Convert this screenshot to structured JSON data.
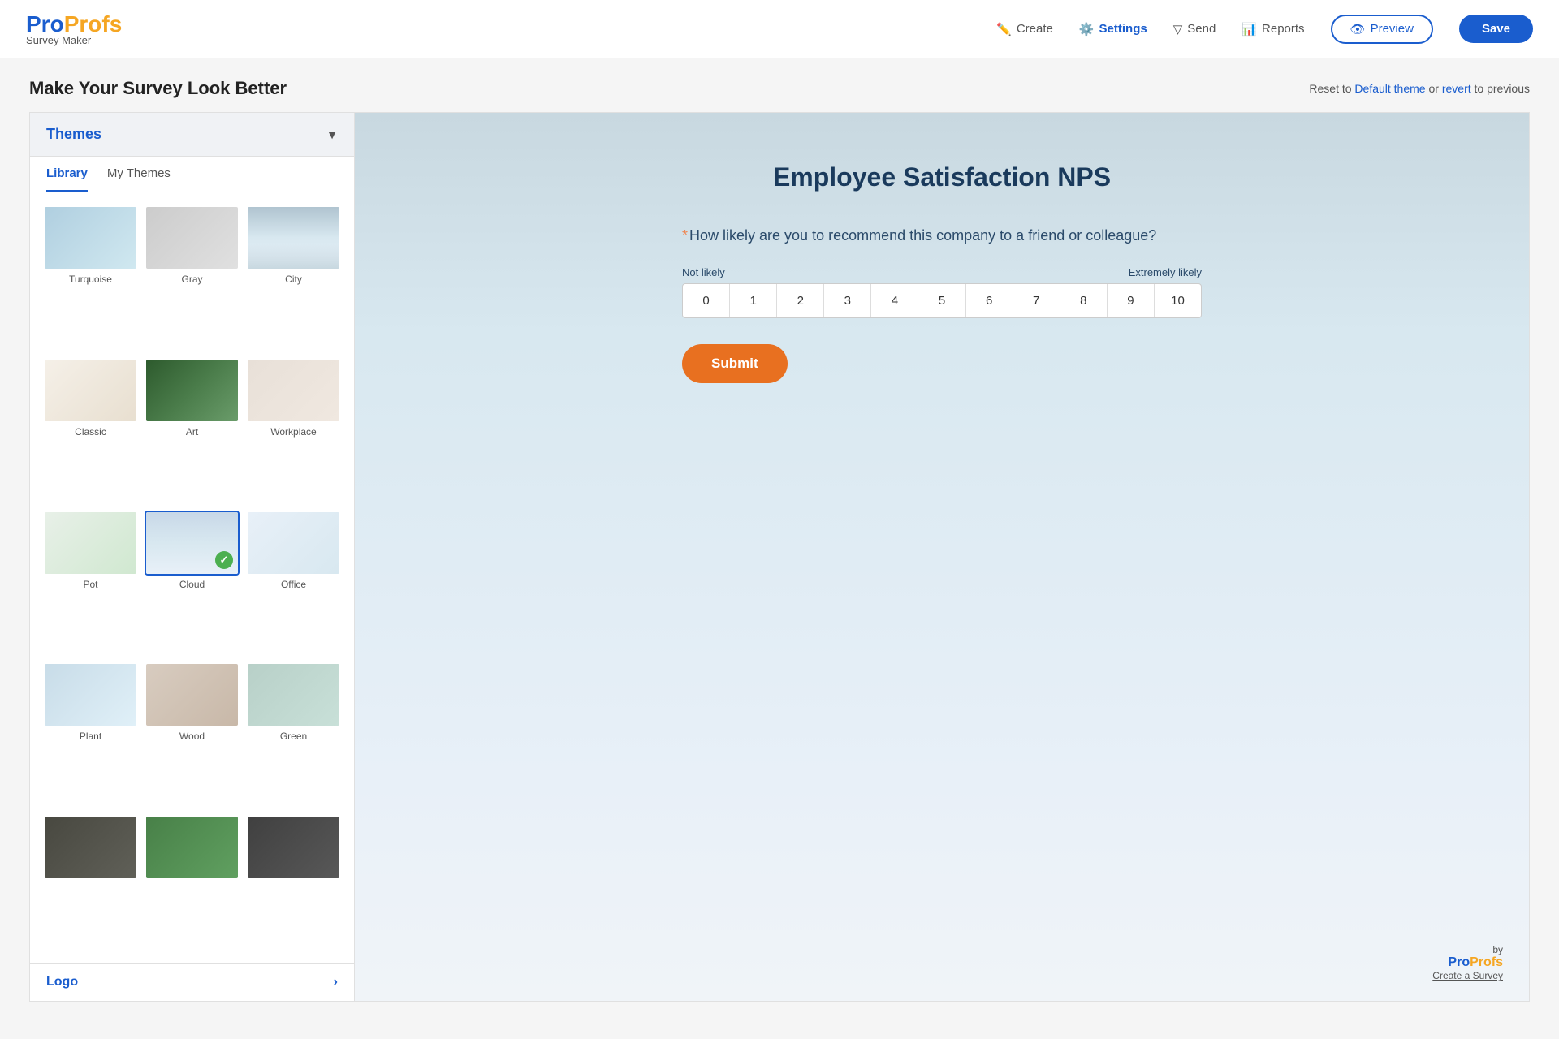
{
  "header": {
    "logo": {
      "pro": "Pro",
      "profs": "Profs",
      "subtitle": "Survey Maker"
    },
    "nav": [
      {
        "id": "create",
        "label": "Create",
        "icon": "✏️",
        "active": false
      },
      {
        "id": "settings",
        "label": "Settings",
        "icon": "⚙️",
        "active": true
      },
      {
        "id": "send",
        "label": "Send",
        "icon": "▽",
        "active": false
      },
      {
        "id": "reports",
        "label": "Reports",
        "icon": "📊",
        "active": false
      }
    ],
    "preview_label": "Preview",
    "save_label": "Save"
  },
  "page": {
    "title": "Make Your Survey Look Better",
    "reset_text": "Reset to",
    "default_theme_link": "Default theme",
    "or_text": "or",
    "revert_link": "revert",
    "revert_suffix": "to previous"
  },
  "sidebar": {
    "title": "Themes",
    "tabs": [
      {
        "id": "library",
        "label": "Library",
        "active": true
      },
      {
        "id": "my-themes",
        "label": "My Themes",
        "active": false
      }
    ],
    "themes": [
      {
        "id": "turquoise",
        "label": "Turquoise",
        "css_class": "turquoise-bg",
        "selected": false
      },
      {
        "id": "gray",
        "label": "Gray",
        "css_class": "gray-bg",
        "selected": false
      },
      {
        "id": "city",
        "label": "City",
        "css_class": "city-bg",
        "selected": false
      },
      {
        "id": "classic",
        "label": "Classic",
        "css_class": "classic-bg",
        "selected": false
      },
      {
        "id": "art",
        "label": "Art",
        "css_class": "art-bg",
        "selected": false
      },
      {
        "id": "workplace",
        "label": "Workplace",
        "css_class": "workplace-bg",
        "selected": false
      },
      {
        "id": "pot",
        "label": "Pot",
        "css_class": "pot-bg",
        "selected": false
      },
      {
        "id": "cloud",
        "label": "Cloud",
        "css_class": "cloud-bg",
        "selected": true
      },
      {
        "id": "office",
        "label": "Office",
        "css_class": "office-bg",
        "selected": false
      },
      {
        "id": "plant",
        "label": "Plant",
        "css_class": "plant-bg",
        "selected": false
      },
      {
        "id": "wood",
        "label": "Wood",
        "css_class": "wood-bg",
        "selected": false
      },
      {
        "id": "green",
        "label": "Green",
        "css_class": "green-bg",
        "selected": false
      },
      {
        "id": "dark1",
        "label": "",
        "css_class": "dark1-bg",
        "selected": false
      },
      {
        "id": "dark2",
        "label": "",
        "css_class": "dark2-bg",
        "selected": false
      },
      {
        "id": "dark3",
        "label": "",
        "css_class": "dark3-bg",
        "selected": false
      }
    ],
    "logo_section_label": "Logo",
    "logo_section_arrow": "›"
  },
  "survey": {
    "title": "Employee Satisfaction NPS",
    "question": "How likely are you to recommend this company to a friend or colleague?",
    "required_marker": "*",
    "scale_min_label": "Not likely",
    "scale_max_label": "Extremely likely",
    "scale_values": [
      "0",
      "1",
      "2",
      "3",
      "4",
      "5",
      "6",
      "7",
      "8",
      "9",
      "10"
    ],
    "submit_label": "Submit"
  },
  "footer": {
    "by_label": "by",
    "logo_pro": "Pro",
    "logo_profs": "Profs",
    "create_link": "Create a Survey"
  }
}
